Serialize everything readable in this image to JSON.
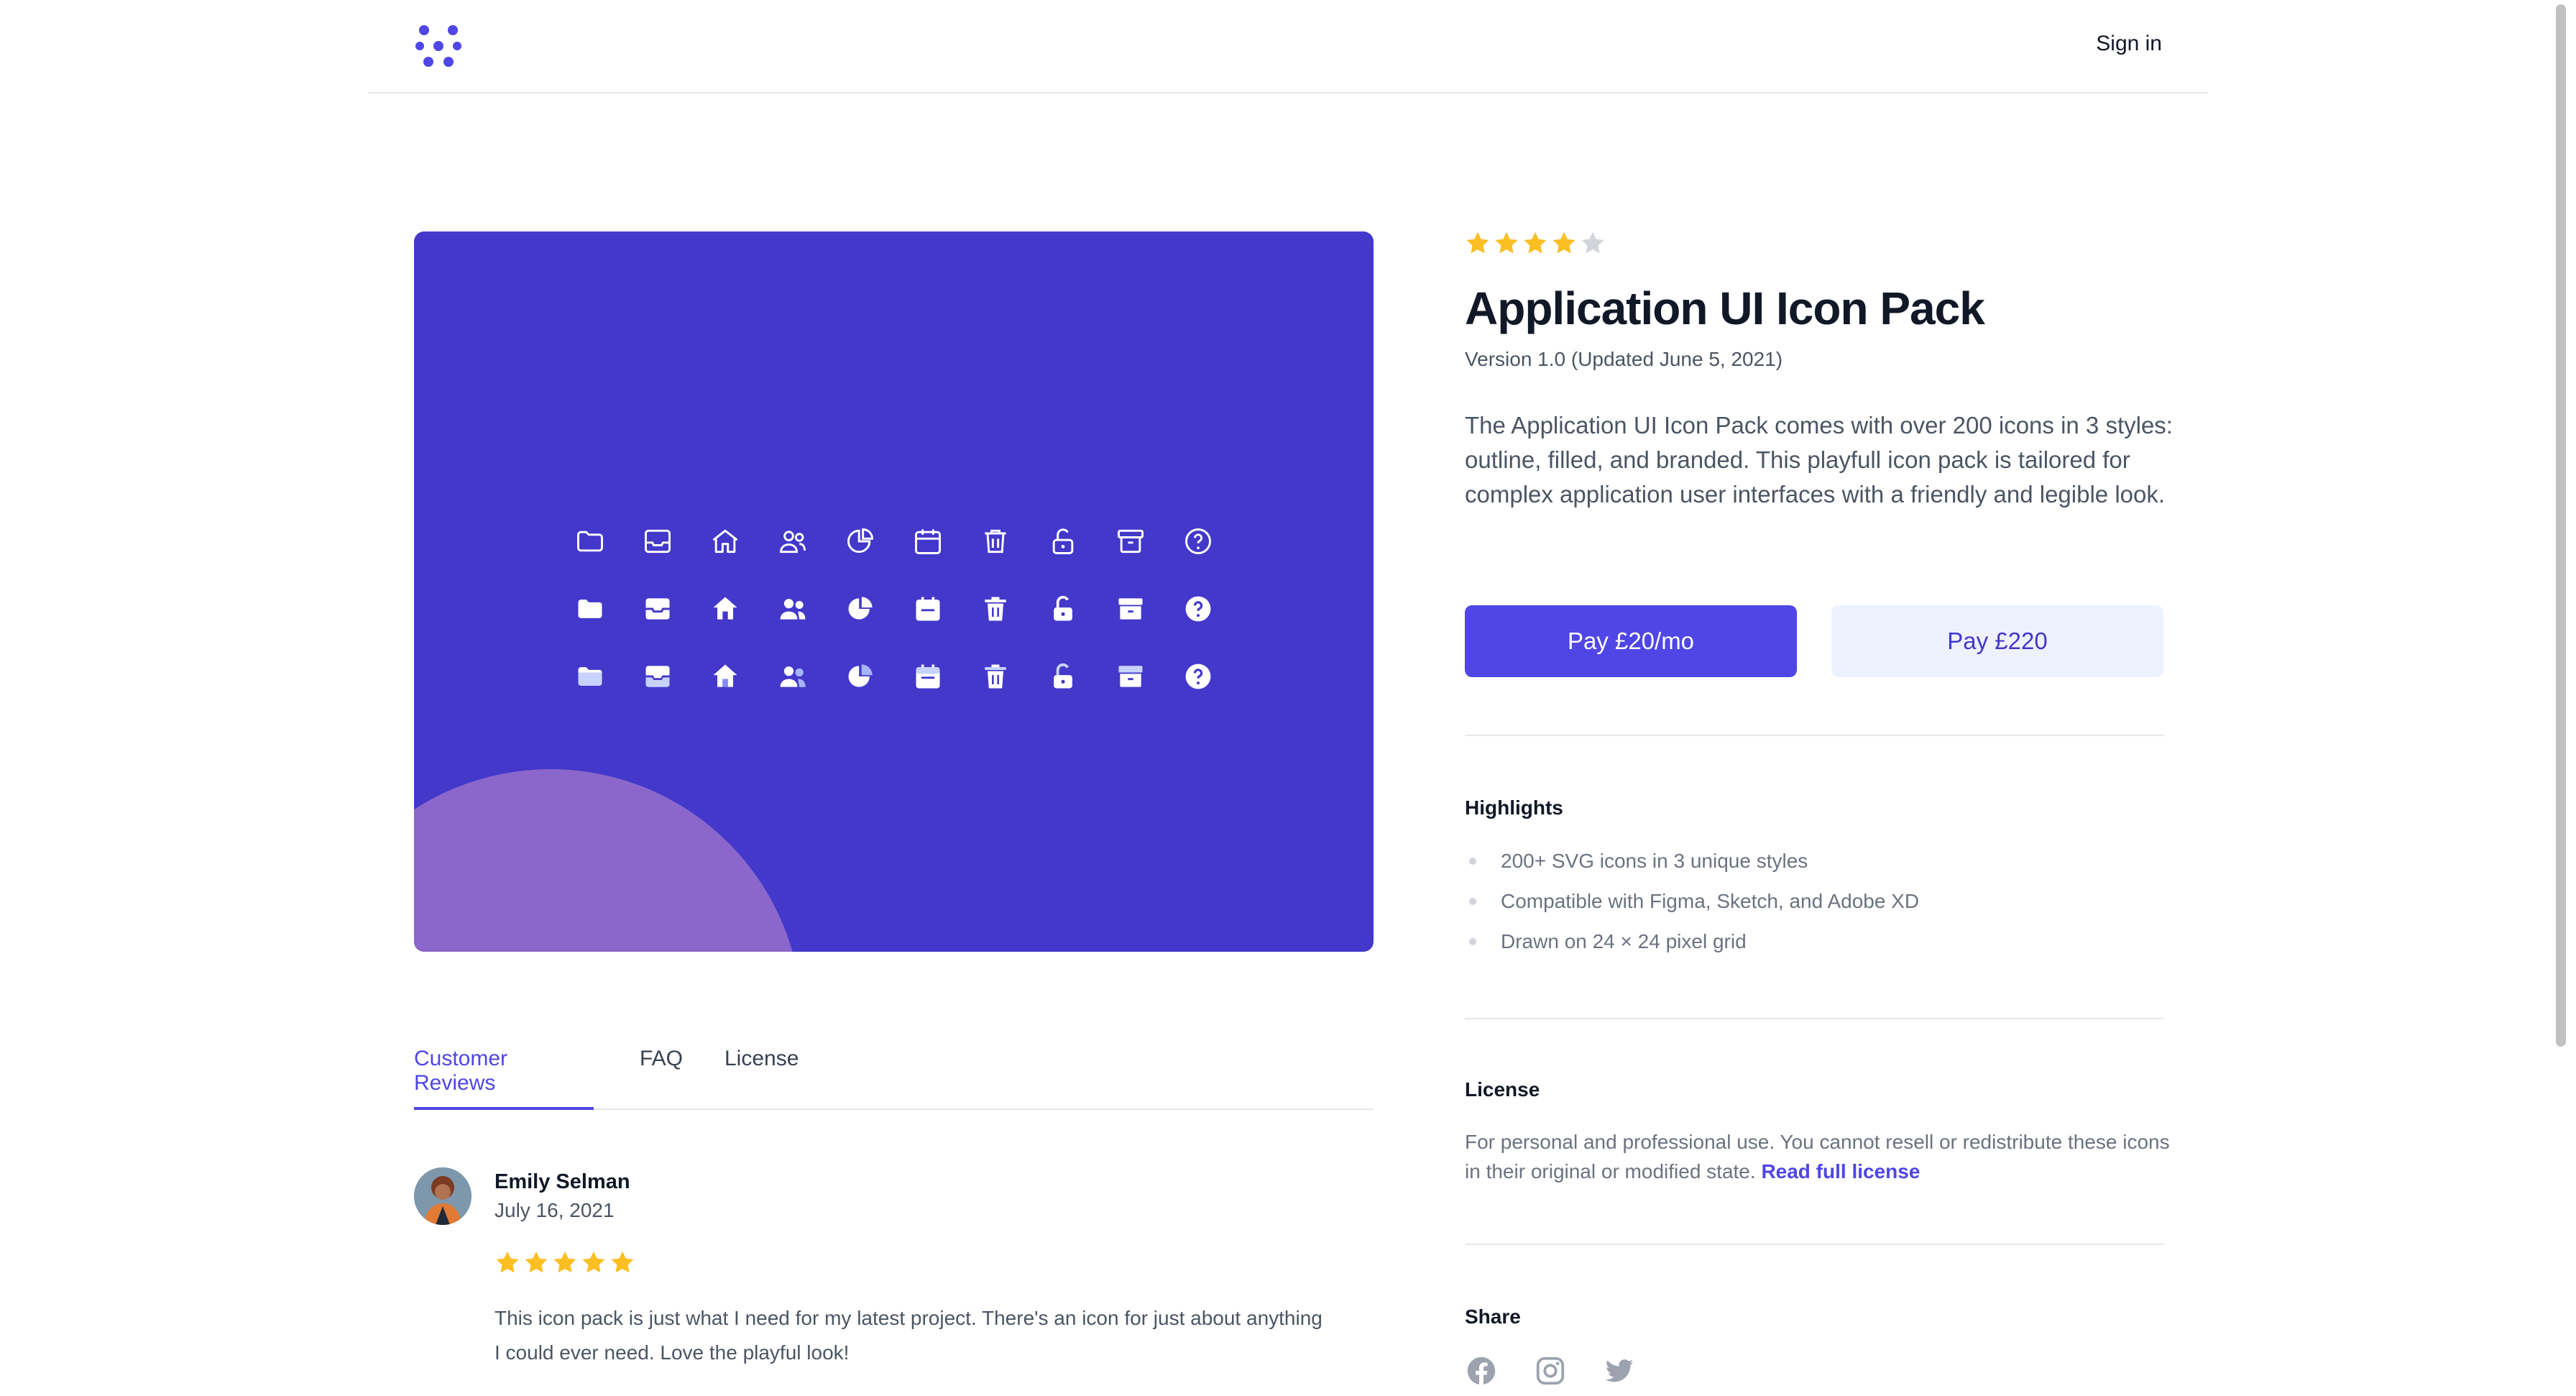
{
  "header": {
    "logo_icon": "brand-logo-icon",
    "signin_label": "Sign in"
  },
  "colors": {
    "accent": "#4f46e5",
    "hero_bg": "#4338ca",
    "star_filled": "#fbbf24",
    "star_empty": "#d1d5db"
  },
  "product": {
    "rating": 4,
    "rating_max": 5,
    "title": "Application UI Icon Pack",
    "version": "Version 1.0 (Updated June 5, 2021)",
    "description": "The Application UI Icon Pack comes with over 200 icons in 3 styles: outline, filled, and branded. This playfull icon pack is tailored for complex application user interfaces with a friendly and legible look.",
    "pay_monthly_label": "Pay £20/mo",
    "pay_once_label": "Pay £220"
  },
  "hero": {
    "icon_names": [
      "folder-icon",
      "inbox-icon",
      "home-icon",
      "users-icon",
      "chart-pie-icon",
      "calendar-icon",
      "trash-icon",
      "lock-open-icon",
      "archive-icon",
      "question-icon"
    ],
    "styles": [
      "outline",
      "filled",
      "branded"
    ]
  },
  "highlights": {
    "heading": "Highlights",
    "items": [
      "200+ SVG icons in 3 unique styles",
      "Compatible with Figma, Sketch, and Adobe XD",
      "Drawn on 24 × 24 pixel grid"
    ]
  },
  "license": {
    "heading": "License",
    "text": "For personal and professional use. You cannot resell or redistribute these icons in their original or modified state.",
    "link_label": "Read full license"
  },
  "share": {
    "heading": "Share",
    "icons": [
      "facebook-icon",
      "instagram-icon",
      "twitter-icon"
    ]
  },
  "tabs": {
    "items": [
      "Customer Reviews",
      "FAQ",
      "License"
    ],
    "active": "Customer Reviews"
  },
  "review": {
    "name": "Emily Selman",
    "date": "July 16, 2021",
    "rating": 5,
    "text": "This icon pack is just what I need for my latest project. There's an icon for just about anything I could ever need. Love the playful look!"
  }
}
